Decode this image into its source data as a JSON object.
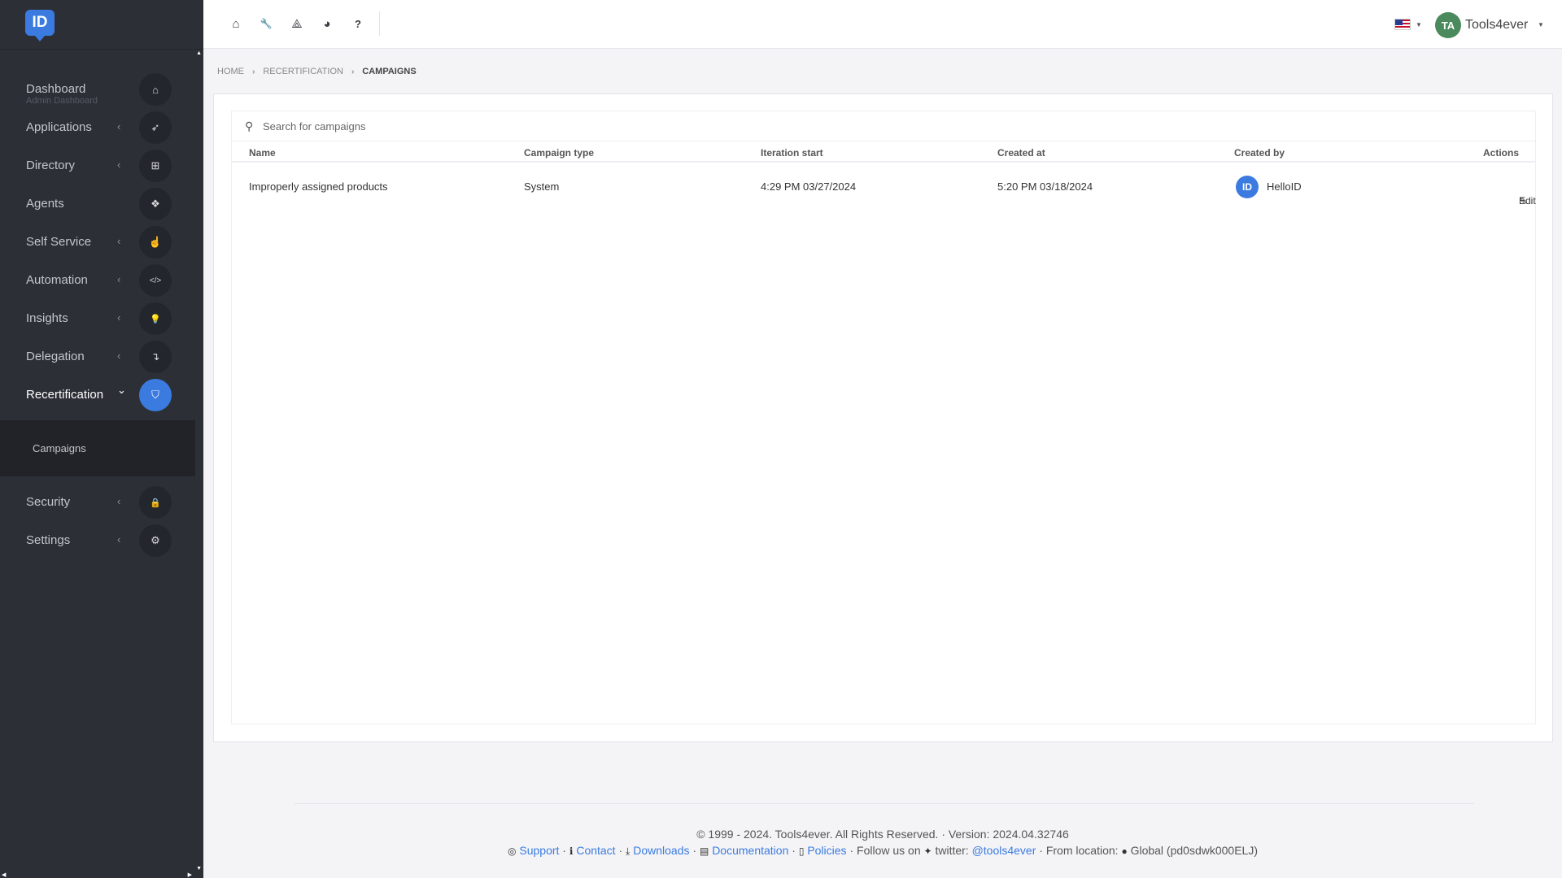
{
  "brand": {
    "logo_text": "ID"
  },
  "sidebar": {
    "items": [
      {
        "label": "Dashboard",
        "sub": "Admin Dashboard",
        "icon": "home-icon",
        "glyph": "⌂",
        "chev": ""
      },
      {
        "label": "Applications",
        "icon": "rocket-icon",
        "glyph": "➶",
        "chev": "‹"
      },
      {
        "label": "Directory",
        "icon": "sitemap-icon",
        "glyph": "⊞",
        "chev": "‹"
      },
      {
        "label": "Agents",
        "icon": "cubes-icon",
        "glyph": "❖",
        "chev": ""
      },
      {
        "label": "Self Service",
        "icon": "hand-pointer-icon",
        "glyph": "☝",
        "chev": "‹"
      },
      {
        "label": "Automation",
        "icon": "code-icon",
        "glyph": "</>",
        "chev": "‹"
      },
      {
        "label": "Insights",
        "icon": "lightbulb-icon",
        "glyph": "💡",
        "chev": "‹"
      },
      {
        "label": "Delegation",
        "icon": "level-down-icon",
        "glyph": "↴",
        "chev": "‹"
      },
      {
        "label": "Recertification",
        "icon": "shield-icon",
        "glyph": "⛉",
        "chev": "⌄"
      },
      {
        "label": "Security",
        "icon": "lock-icon",
        "glyph": "🔒",
        "chev": "‹"
      },
      {
        "label": "Settings",
        "icon": "gear-icon",
        "glyph": "⚙",
        "chev": "‹"
      }
    ],
    "subitems": {
      "campaigns": "Campaigns"
    }
  },
  "topbar": {
    "icons": [
      {
        "name": "home-icon",
        "glyph": "⌂"
      },
      {
        "name": "wrench-icon",
        "glyph": "🔧"
      },
      {
        "name": "network-icon",
        "glyph": "⟁"
      },
      {
        "name": "pie-chart-icon",
        "glyph": "◕"
      },
      {
        "name": "help-icon",
        "glyph": "?"
      }
    ],
    "avatar_initials": "TA",
    "username": "Tools4ever"
  },
  "breadcrumb": {
    "home": "HOME",
    "recertification": "RECERTIFICATION",
    "current": "CAMPAIGNS"
  },
  "search": {
    "placeholder": "Search for campaigns"
  },
  "table": {
    "headers": {
      "name": "Name",
      "type": "Campaign type",
      "iteration": "Iteration start",
      "created_at": "Created at",
      "created_by": "Created by",
      "actions": "Actions"
    },
    "rows": [
      {
        "name": "Improperly assigned products",
        "type": "System",
        "iteration": "4:29 PM 03/27/2024",
        "created_at": "5:20 PM 03/18/2024",
        "created_by_logo": "ID",
        "created_by": "HelloID",
        "action": "Edit"
      }
    ]
  },
  "footer": {
    "copyright": "© 1999 - 2024. Tools4ever. All Rights Reserved. · Version: 2024.04.32746",
    "support": "Support",
    "contact": "Contact",
    "downloads": "Downloads",
    "documentation": "Documentation",
    "policies": "Policies",
    "follow": "Follow us on",
    "twitter_label": "twitter:",
    "twitter_handle": "@tools4ever",
    "from_location": "From location:",
    "location": "Global (pd0sdwk000ELJ)"
  },
  "colors": {
    "accent": "#3b7be0",
    "sidebar_bg": "#2c2f36",
    "avatar_bg": "#4a8a5c"
  }
}
